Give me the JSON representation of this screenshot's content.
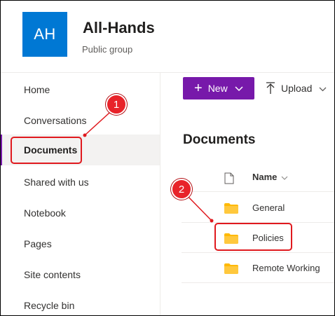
{
  "site": {
    "logo_text": "AH",
    "title": "All-Hands",
    "subtitle": "Public group"
  },
  "nav": {
    "items": [
      {
        "label": "Home"
      },
      {
        "label": "Conversations"
      },
      {
        "label": "Documents",
        "selected": true
      },
      {
        "label": "Shared with us"
      },
      {
        "label": "Notebook"
      },
      {
        "label": "Pages"
      },
      {
        "label": "Site contents"
      },
      {
        "label": "Recycle bin"
      }
    ]
  },
  "commandbar": {
    "new_label": "New",
    "upload_label": "Upload"
  },
  "library": {
    "title": "Documents",
    "column_name": "Name",
    "rows": [
      {
        "name": "General"
      },
      {
        "name": "Policies"
      },
      {
        "name": "Remote Working"
      }
    ]
  },
  "annotations": {
    "badge_1": "1",
    "badge_2": "2"
  },
  "colors": {
    "brand": "#0078d4",
    "accent": "#7719aa",
    "callout": "#e0191e",
    "folder": "#ffb900"
  }
}
